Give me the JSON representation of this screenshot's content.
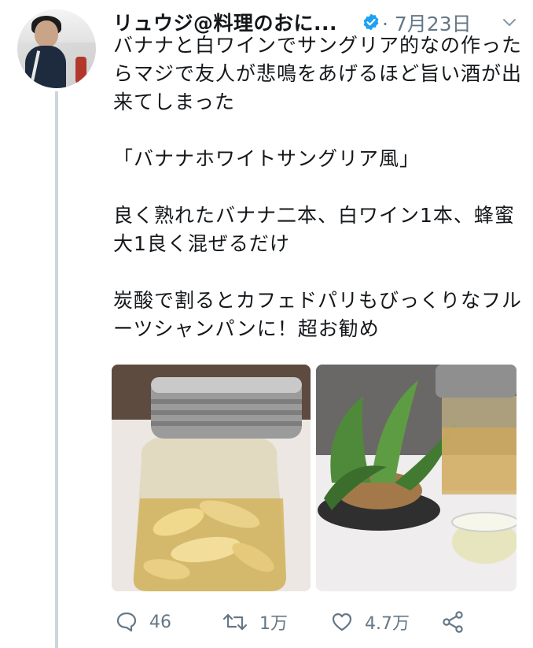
{
  "tweet": {
    "author_name": "リュウジ@料理のおに...",
    "date": "· 7月23日",
    "text": "バナナと白ワインでサングリア的なの作ったらマジで友人が悲鳴をあげるほど旨い酒が出来てしまった\n\n「バナナホワイトサングリア風」\n\n良く熟れたバナナ二本、白ワイン1本、蜂蜜大1良く混ぜるだけ\n\n炭酸で割るとカフェドパリもびっくりなフルーツシャンパンに！超お勧め",
    "accent_color": "#1da1f2"
  },
  "actions": {
    "replies": "46",
    "retweets": "1万",
    "likes": "4.7万"
  },
  "icons": {
    "verified": "verified-badge-icon",
    "caret": "chevron-down-icon",
    "reply": "speech-bubble-icon",
    "retweet": "retweet-arrows-icon",
    "like": "heart-icon",
    "share": "share-nodes-icon"
  }
}
